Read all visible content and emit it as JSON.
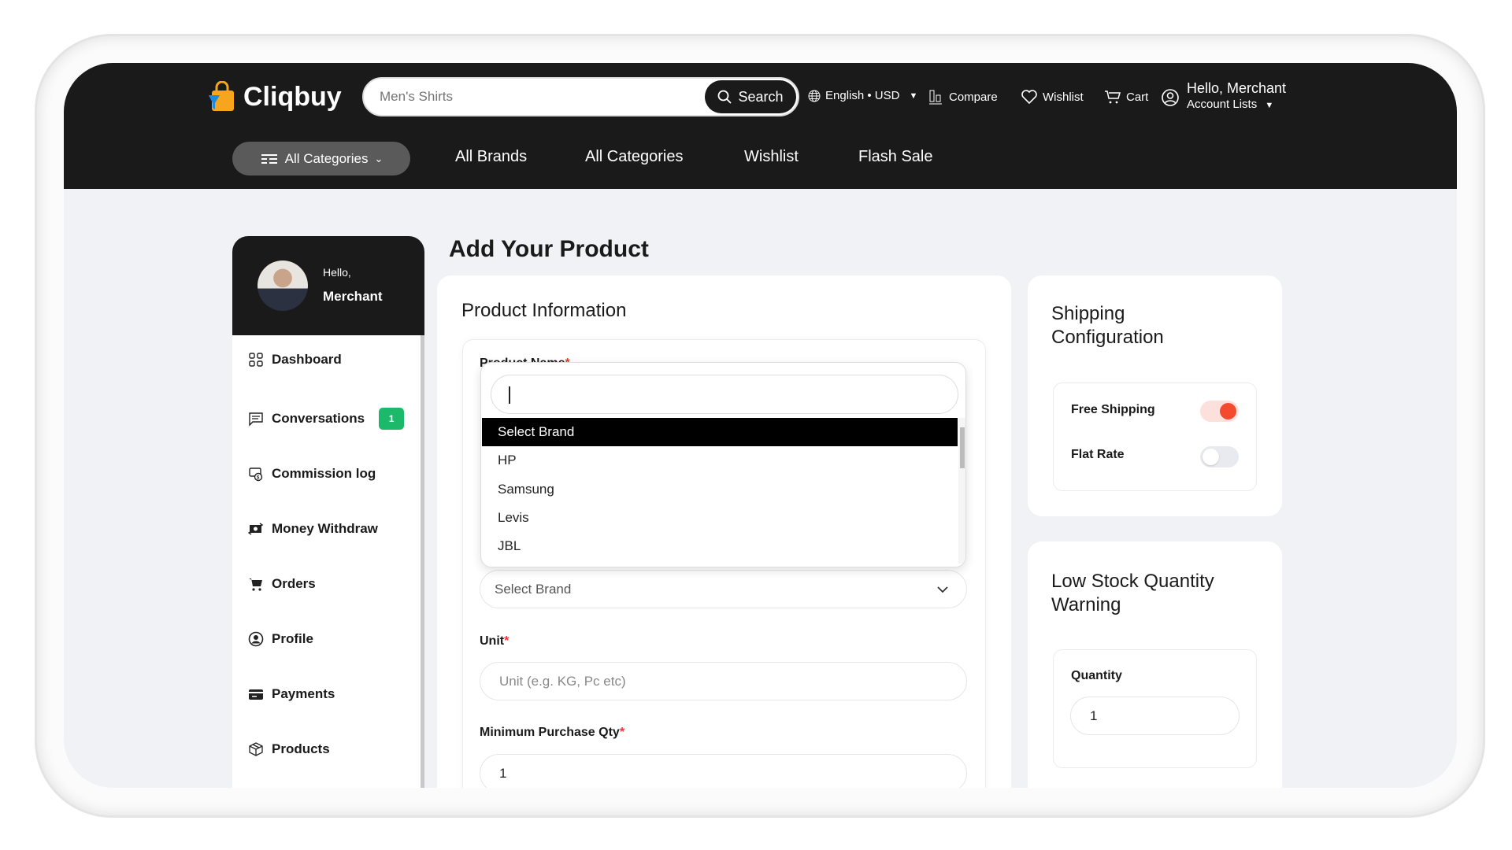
{
  "header": {
    "brand": "Cliqbuy",
    "search": {
      "value": "",
      "placeholder": "Men's Shirts",
      "button_label": "Search"
    },
    "language_currency": "English • USD",
    "compare": "Compare",
    "wishlist": "Wishlist",
    "cart": "Cart",
    "account_greeting": "Hello, Merchant",
    "account_lists": "Account Lists"
  },
  "nav": {
    "categories_button": "All Categories",
    "links": [
      "All Brands",
      "All Categories",
      "Wishlist",
      "Flash Sale"
    ]
  },
  "sidebar": {
    "greeting": "Hello,",
    "user": "Merchant",
    "items": [
      {
        "label": "Dashboard",
        "icon": "grid-icon"
      },
      {
        "label": "Conversations",
        "icon": "chat-icon",
        "badge": "1"
      },
      {
        "label": "Commission log",
        "icon": "commission-icon"
      },
      {
        "label": "Money Withdraw",
        "icon": "money-icon"
      },
      {
        "label": "Orders",
        "icon": "cart-icon"
      },
      {
        "label": "Profile",
        "icon": "user-circle-icon"
      },
      {
        "label": "Payments",
        "icon": "card-icon"
      },
      {
        "label": "Products",
        "icon": "box-icon"
      }
    ]
  },
  "main": {
    "page_title": "Add Your Product",
    "product_info": {
      "title": "Product Information",
      "product_name_label": "Product Name",
      "brand_dropdown": {
        "search_value": "",
        "options": [
          "Select Brand",
          "HP",
          "Samsung",
          "Levis",
          "JBL"
        ],
        "highlighted": "Select Brand"
      },
      "brand_select_value": "Select Brand",
      "unit_label": "Unit",
      "unit_placeholder": "Unit (e.g. KG, Pc etc)",
      "min_qty_label": "Minimum Purchase Qty",
      "min_qty_value": "1",
      "required_mark": "*"
    },
    "shipping": {
      "title": "Shipping Configuration",
      "free_shipping": {
        "label": "Free Shipping",
        "on": true
      },
      "flat_rate": {
        "label": "Flat Rate",
        "on": false
      }
    },
    "low_stock": {
      "title": "Low Stock Quantity Warning",
      "quantity_label": "Quantity",
      "quantity_value": "1"
    }
  },
  "colors": {
    "header": "#1a1a1a",
    "accent": "#f44b2f",
    "badge": "#1db96a",
    "background": "#f0f2f5"
  }
}
